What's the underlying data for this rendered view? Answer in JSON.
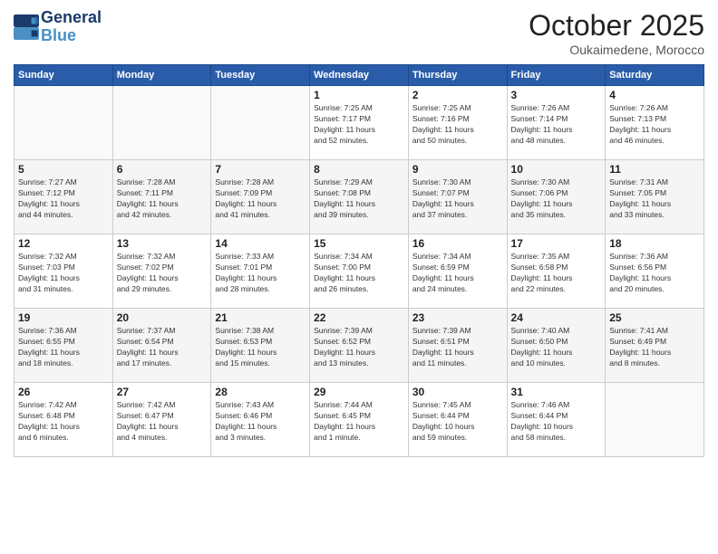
{
  "logo": {
    "line1": "General",
    "line2": "Blue"
  },
  "title": "October 2025",
  "location": "Oukaimedene, Morocco",
  "header_days": [
    "Sunday",
    "Monday",
    "Tuesday",
    "Wednesday",
    "Thursday",
    "Friday",
    "Saturday"
  ],
  "weeks": [
    [
      {
        "day": "",
        "info": ""
      },
      {
        "day": "",
        "info": ""
      },
      {
        "day": "",
        "info": ""
      },
      {
        "day": "1",
        "info": "Sunrise: 7:25 AM\nSunset: 7:17 PM\nDaylight: 11 hours\nand 52 minutes."
      },
      {
        "day": "2",
        "info": "Sunrise: 7:25 AM\nSunset: 7:16 PM\nDaylight: 11 hours\nand 50 minutes."
      },
      {
        "day": "3",
        "info": "Sunrise: 7:26 AM\nSunset: 7:14 PM\nDaylight: 11 hours\nand 48 minutes."
      },
      {
        "day": "4",
        "info": "Sunrise: 7:26 AM\nSunset: 7:13 PM\nDaylight: 11 hours\nand 46 minutes."
      }
    ],
    [
      {
        "day": "5",
        "info": "Sunrise: 7:27 AM\nSunset: 7:12 PM\nDaylight: 11 hours\nand 44 minutes."
      },
      {
        "day": "6",
        "info": "Sunrise: 7:28 AM\nSunset: 7:11 PM\nDaylight: 11 hours\nand 42 minutes."
      },
      {
        "day": "7",
        "info": "Sunrise: 7:28 AM\nSunset: 7:09 PM\nDaylight: 11 hours\nand 41 minutes."
      },
      {
        "day": "8",
        "info": "Sunrise: 7:29 AM\nSunset: 7:08 PM\nDaylight: 11 hours\nand 39 minutes."
      },
      {
        "day": "9",
        "info": "Sunrise: 7:30 AM\nSunset: 7:07 PM\nDaylight: 11 hours\nand 37 minutes."
      },
      {
        "day": "10",
        "info": "Sunrise: 7:30 AM\nSunset: 7:06 PM\nDaylight: 11 hours\nand 35 minutes."
      },
      {
        "day": "11",
        "info": "Sunrise: 7:31 AM\nSunset: 7:05 PM\nDaylight: 11 hours\nand 33 minutes."
      }
    ],
    [
      {
        "day": "12",
        "info": "Sunrise: 7:32 AM\nSunset: 7:03 PM\nDaylight: 11 hours\nand 31 minutes."
      },
      {
        "day": "13",
        "info": "Sunrise: 7:32 AM\nSunset: 7:02 PM\nDaylight: 11 hours\nand 29 minutes."
      },
      {
        "day": "14",
        "info": "Sunrise: 7:33 AM\nSunset: 7:01 PM\nDaylight: 11 hours\nand 28 minutes."
      },
      {
        "day": "15",
        "info": "Sunrise: 7:34 AM\nSunset: 7:00 PM\nDaylight: 11 hours\nand 26 minutes."
      },
      {
        "day": "16",
        "info": "Sunrise: 7:34 AM\nSunset: 6:59 PM\nDaylight: 11 hours\nand 24 minutes."
      },
      {
        "day": "17",
        "info": "Sunrise: 7:35 AM\nSunset: 6:58 PM\nDaylight: 11 hours\nand 22 minutes."
      },
      {
        "day": "18",
        "info": "Sunrise: 7:36 AM\nSunset: 6:56 PM\nDaylight: 11 hours\nand 20 minutes."
      }
    ],
    [
      {
        "day": "19",
        "info": "Sunrise: 7:36 AM\nSunset: 6:55 PM\nDaylight: 11 hours\nand 18 minutes."
      },
      {
        "day": "20",
        "info": "Sunrise: 7:37 AM\nSunset: 6:54 PM\nDaylight: 11 hours\nand 17 minutes."
      },
      {
        "day": "21",
        "info": "Sunrise: 7:38 AM\nSunset: 6:53 PM\nDaylight: 11 hours\nand 15 minutes."
      },
      {
        "day": "22",
        "info": "Sunrise: 7:39 AM\nSunset: 6:52 PM\nDaylight: 11 hours\nand 13 minutes."
      },
      {
        "day": "23",
        "info": "Sunrise: 7:39 AM\nSunset: 6:51 PM\nDaylight: 11 hours\nand 11 minutes."
      },
      {
        "day": "24",
        "info": "Sunrise: 7:40 AM\nSunset: 6:50 PM\nDaylight: 11 hours\nand 10 minutes."
      },
      {
        "day": "25",
        "info": "Sunrise: 7:41 AM\nSunset: 6:49 PM\nDaylight: 11 hours\nand 8 minutes."
      }
    ],
    [
      {
        "day": "26",
        "info": "Sunrise: 7:42 AM\nSunset: 6:48 PM\nDaylight: 11 hours\nand 6 minutes."
      },
      {
        "day": "27",
        "info": "Sunrise: 7:42 AM\nSunset: 6:47 PM\nDaylight: 11 hours\nand 4 minutes."
      },
      {
        "day": "28",
        "info": "Sunrise: 7:43 AM\nSunset: 6:46 PM\nDaylight: 11 hours\nand 3 minutes."
      },
      {
        "day": "29",
        "info": "Sunrise: 7:44 AM\nSunset: 6:45 PM\nDaylight: 11 hours\nand 1 minute."
      },
      {
        "day": "30",
        "info": "Sunrise: 7:45 AM\nSunset: 6:44 PM\nDaylight: 10 hours\nand 59 minutes."
      },
      {
        "day": "31",
        "info": "Sunrise: 7:46 AM\nSunset: 6:44 PM\nDaylight: 10 hours\nand 58 minutes."
      },
      {
        "day": "",
        "info": ""
      }
    ]
  ]
}
